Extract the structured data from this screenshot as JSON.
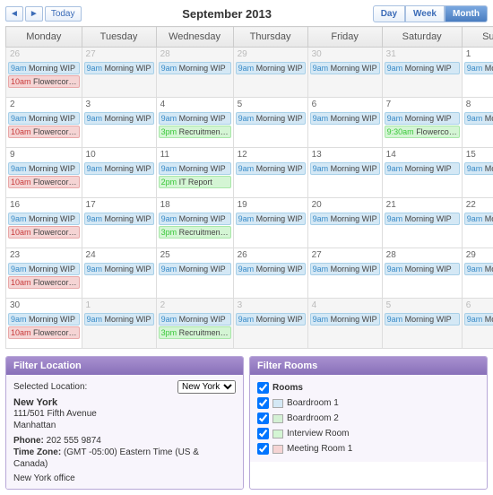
{
  "header": {
    "today": "Today",
    "title": "September 2013",
    "prev": "◄",
    "next": "►",
    "views": [
      "Day",
      "Week",
      "Month"
    ],
    "activeView": 2
  },
  "days": [
    "Monday",
    "Tuesday",
    "Wednesday",
    "Thursday",
    "Friday",
    "Saturday",
    "Sunday"
  ],
  "weeks": [
    [
      {
        "n": 26,
        "o": true,
        "ev": [
          {
            "t": "9am",
            "x": "Morning WIP",
            "c": "blue"
          },
          {
            "t": "10am",
            "x": "Flowercor…",
            "c": "red"
          }
        ]
      },
      {
        "n": 27,
        "o": true,
        "ev": [
          {
            "t": "9am",
            "x": "Morning WIP",
            "c": "blue"
          }
        ]
      },
      {
        "n": 28,
        "o": true,
        "ev": [
          {
            "t": "9am",
            "x": "Morning WIP",
            "c": "blue"
          }
        ]
      },
      {
        "n": 29,
        "o": true,
        "ev": [
          {
            "t": "9am",
            "x": "Morning WIP",
            "c": "blue"
          }
        ]
      },
      {
        "n": 30,
        "o": true,
        "ev": [
          {
            "t": "9am",
            "x": "Morning WIP",
            "c": "blue"
          }
        ]
      },
      {
        "n": 31,
        "o": true,
        "ev": [
          {
            "t": "9am",
            "x": "Morning WIP",
            "c": "blue"
          }
        ]
      },
      {
        "n": 1,
        "o": false,
        "ev": [
          {
            "t": "9am",
            "x": "Morning WIP",
            "c": "blue"
          }
        ]
      }
    ],
    [
      {
        "n": 2,
        "o": false,
        "ev": [
          {
            "t": "9am",
            "x": "Morning WIP",
            "c": "blue"
          },
          {
            "t": "10am",
            "x": "Flowercor…",
            "c": "red"
          }
        ]
      },
      {
        "n": 3,
        "o": false,
        "ev": [
          {
            "t": "9am",
            "x": "Morning WIP",
            "c": "blue"
          }
        ]
      },
      {
        "n": 4,
        "o": false,
        "ev": [
          {
            "t": "9am",
            "x": "Morning WIP",
            "c": "blue"
          },
          {
            "t": "3pm",
            "x": "Recruitmen…",
            "c": "green"
          }
        ]
      },
      {
        "n": 5,
        "o": false,
        "ev": [
          {
            "t": "9am",
            "x": "Morning WIP",
            "c": "blue"
          }
        ]
      },
      {
        "n": 6,
        "o": false,
        "ev": [
          {
            "t": "9am",
            "x": "Morning WIP",
            "c": "blue"
          }
        ]
      },
      {
        "n": 7,
        "o": false,
        "ev": [
          {
            "t": "9am",
            "x": "Morning WIP",
            "c": "blue"
          },
          {
            "t": "9:30am",
            "x": "Flowerco…",
            "c": "green"
          }
        ]
      },
      {
        "n": 8,
        "o": false,
        "ev": [
          {
            "t": "9am",
            "x": "Morning WIP",
            "c": "blue"
          }
        ]
      }
    ],
    [
      {
        "n": 9,
        "o": false,
        "ev": [
          {
            "t": "9am",
            "x": "Morning WIP",
            "c": "blue"
          },
          {
            "t": "10am",
            "x": "Flowercor…",
            "c": "red"
          }
        ]
      },
      {
        "n": 10,
        "o": false,
        "ev": [
          {
            "t": "9am",
            "x": "Morning WIP",
            "c": "blue"
          }
        ]
      },
      {
        "n": 11,
        "o": false,
        "ev": [
          {
            "t": "9am",
            "x": "Morning WIP",
            "c": "blue"
          },
          {
            "t": "2pm",
            "x": "IT Report",
            "c": "green"
          }
        ]
      },
      {
        "n": 12,
        "o": false,
        "ev": [
          {
            "t": "9am",
            "x": "Morning WIP",
            "c": "blue"
          }
        ]
      },
      {
        "n": 13,
        "o": false,
        "ev": [
          {
            "t": "9am",
            "x": "Morning WIP",
            "c": "blue"
          }
        ]
      },
      {
        "n": 14,
        "o": false,
        "ev": [
          {
            "t": "9am",
            "x": "Morning WIP",
            "c": "blue"
          }
        ]
      },
      {
        "n": 15,
        "o": false,
        "ev": [
          {
            "t": "9am",
            "x": "Morning WIP",
            "c": "blue"
          }
        ]
      }
    ],
    [
      {
        "n": 16,
        "o": false,
        "ev": [
          {
            "t": "9am",
            "x": "Morning WIP",
            "c": "blue"
          },
          {
            "t": "10am",
            "x": "Flowercor…",
            "c": "red"
          }
        ]
      },
      {
        "n": 17,
        "o": false,
        "ev": [
          {
            "t": "9am",
            "x": "Morning WIP",
            "c": "blue"
          }
        ]
      },
      {
        "n": 18,
        "o": false,
        "ev": [
          {
            "t": "9am",
            "x": "Morning WIP",
            "c": "blue"
          },
          {
            "t": "3pm",
            "x": "Recruitmen…",
            "c": "green"
          }
        ]
      },
      {
        "n": 19,
        "o": false,
        "ev": [
          {
            "t": "9am",
            "x": "Morning WIP",
            "c": "blue"
          }
        ]
      },
      {
        "n": 20,
        "o": false,
        "ev": [
          {
            "t": "9am",
            "x": "Morning WIP",
            "c": "blue"
          }
        ]
      },
      {
        "n": 21,
        "o": false,
        "ev": [
          {
            "t": "9am",
            "x": "Morning WIP",
            "c": "blue"
          }
        ]
      },
      {
        "n": 22,
        "o": false,
        "ev": [
          {
            "t": "9am",
            "x": "Morning WIP",
            "c": "blue"
          }
        ]
      }
    ],
    [
      {
        "n": 23,
        "o": false,
        "ev": [
          {
            "t": "9am",
            "x": "Morning WIP",
            "c": "blue"
          },
          {
            "t": "10am",
            "x": "Flowercor…",
            "c": "red"
          }
        ]
      },
      {
        "n": 24,
        "o": false,
        "ev": [
          {
            "t": "9am",
            "x": "Morning WIP",
            "c": "blue"
          }
        ]
      },
      {
        "n": 25,
        "o": false,
        "ev": [
          {
            "t": "9am",
            "x": "Morning WIP",
            "c": "blue"
          }
        ]
      },
      {
        "n": 26,
        "o": false,
        "ev": [
          {
            "t": "9am",
            "x": "Morning WIP",
            "c": "blue"
          }
        ]
      },
      {
        "n": 27,
        "o": false,
        "ev": [
          {
            "t": "9am",
            "x": "Morning WIP",
            "c": "blue"
          }
        ]
      },
      {
        "n": 28,
        "o": false,
        "ev": [
          {
            "t": "9am",
            "x": "Morning WIP",
            "c": "blue"
          }
        ]
      },
      {
        "n": 29,
        "o": false,
        "ev": [
          {
            "t": "9am",
            "x": "Morning WIP",
            "c": "blue"
          }
        ]
      }
    ],
    [
      {
        "n": 30,
        "o": false,
        "ev": [
          {
            "t": "9am",
            "x": "Morning WIP",
            "c": "blue"
          },
          {
            "t": "10am",
            "x": "Flowercor…",
            "c": "red"
          }
        ]
      },
      {
        "n": 1,
        "o": true,
        "ev": [
          {
            "t": "9am",
            "x": "Morning WIP",
            "c": "blue"
          }
        ]
      },
      {
        "n": 2,
        "o": true,
        "ev": [
          {
            "t": "9am",
            "x": "Morning WIP",
            "c": "blue"
          },
          {
            "t": "3pm",
            "x": "Recruitmen…",
            "c": "green"
          }
        ]
      },
      {
        "n": 3,
        "o": true,
        "ev": [
          {
            "t": "9am",
            "x": "Morning WIP",
            "c": "blue"
          }
        ]
      },
      {
        "n": 4,
        "o": true,
        "ev": [
          {
            "t": "9am",
            "x": "Morning WIP",
            "c": "blue"
          }
        ]
      },
      {
        "n": 5,
        "o": true,
        "ev": [
          {
            "t": "9am",
            "x": "Morning WIP",
            "c": "blue"
          }
        ]
      },
      {
        "n": 6,
        "o": true,
        "ev": [
          {
            "t": "9am",
            "x": "Morning WIP",
            "c": "blue"
          }
        ]
      }
    ]
  ],
  "filterLoc": {
    "title": "Filter Location",
    "selLabel": "Selected Location:",
    "options": [
      "New York"
    ],
    "name": "New York",
    "addr1": "111/501 Fifth Avenue",
    "addr2": "Manhattan",
    "phoneLabel": "Phone:",
    "phone": "202 555 9874",
    "tzLabel": "Time Zone:",
    "tz": "(GMT -05:00) Eastern Time (US & Canada)",
    "desc": "New York office"
  },
  "filterRooms": {
    "title": "Filter Rooms",
    "all": "Rooms",
    "rooms": [
      {
        "name": "Boardroom 1",
        "sw": "sw1"
      },
      {
        "name": "Boardroom 2",
        "sw": "sw2"
      },
      {
        "name": "Interview Room",
        "sw": "sw3"
      },
      {
        "name": "Meeting Room 1",
        "sw": "sw4"
      }
    ]
  }
}
